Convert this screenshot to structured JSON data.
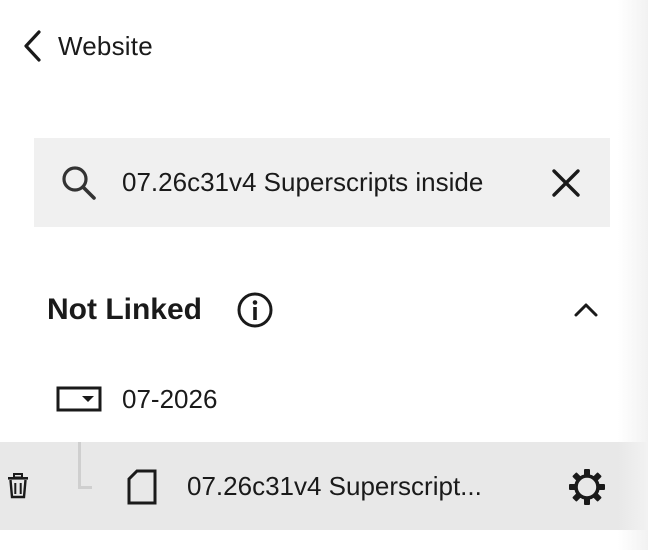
{
  "header": {
    "back_label": "Website",
    "back_icon": "chevron-left-icon"
  },
  "search": {
    "value": "07.26c31v4 Superscripts inside",
    "search_icon": "search-icon",
    "clear_icon": "close-icon"
  },
  "section": {
    "title": "Not Linked",
    "info_icon": "info-icon",
    "collapse_icon": "chevron-up-icon"
  },
  "folder": {
    "label": "07-2026",
    "icon": "folder-dropdown-icon"
  },
  "page_item": {
    "label": "07.26c31v4 Superscript...",
    "icon": "page-icon",
    "delete_icon": "trash-icon",
    "settings_icon": "gear-icon"
  }
}
